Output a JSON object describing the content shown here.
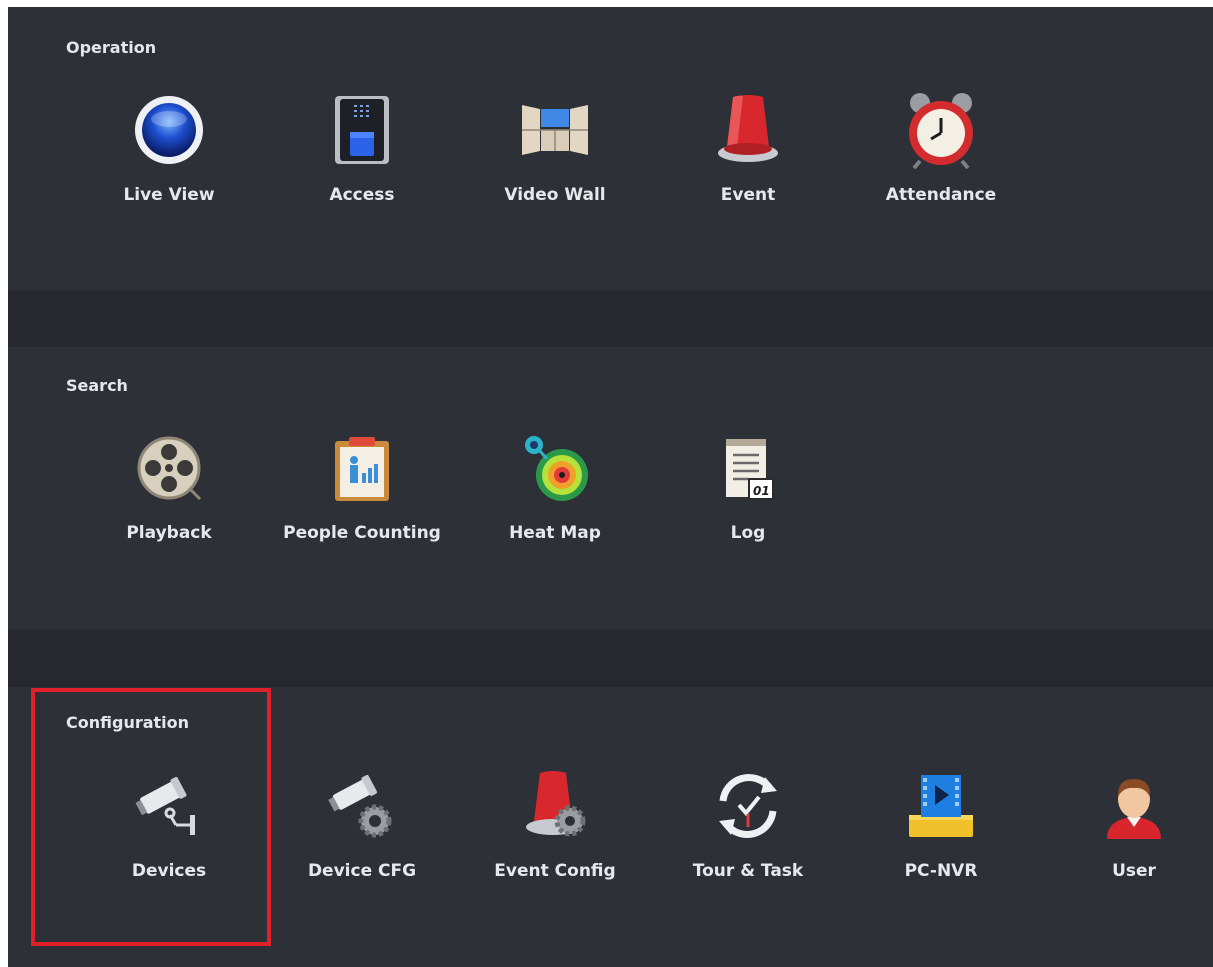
{
  "sections": [
    {
      "title": "Operation",
      "items": [
        {
          "label": "Live View",
          "icon": "live-view-icon"
        },
        {
          "label": "Access",
          "icon": "access-control-icon"
        },
        {
          "label": "Video Wall",
          "icon": "video-wall-icon"
        },
        {
          "label": "Event",
          "icon": "alarm-light-icon"
        },
        {
          "label": "Attendance",
          "icon": "alarm-clock-icon"
        }
      ]
    },
    {
      "title": "Search",
      "items": [
        {
          "label": "Playback",
          "icon": "film-reel-icon"
        },
        {
          "label": "People Counting",
          "icon": "people-counting-icon"
        },
        {
          "label": "Heat Map",
          "icon": "heat-map-icon"
        },
        {
          "label": "Log",
          "icon": "log-notepad-icon"
        }
      ]
    },
    {
      "title": "Configuration",
      "items": [
        {
          "label": "Devices",
          "icon": "camera-icon"
        },
        {
          "label": "Device CFG",
          "icon": "camera-gear-icon"
        },
        {
          "label": "Event Config",
          "icon": "alarm-gear-icon"
        },
        {
          "label": "Tour & Task",
          "icon": "clock-cycle-icon"
        },
        {
          "label": "PC-NVR",
          "icon": "pc-nvr-icon"
        },
        {
          "label": "User",
          "icon": "user-avatar-icon"
        }
      ]
    }
  ],
  "highlight_color": "#e0202a"
}
